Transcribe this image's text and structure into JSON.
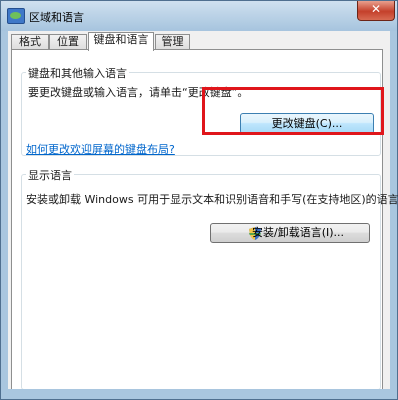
{
  "window": {
    "title": "区域和语言",
    "close_glyph": "✕"
  },
  "tabs": [
    {
      "label": "格式",
      "active": false
    },
    {
      "label": "位置",
      "active": false
    },
    {
      "label": "键盘和语言",
      "active": true
    },
    {
      "label": "管理",
      "active": false
    }
  ],
  "keyboards_group": {
    "title": "键盘和其他输入语言",
    "instruction": "要更改键盘或输入语言，请单击“更改键盘”。",
    "change_keyboard_button": "更改键盘(C)...",
    "help_link": "如何更改欢迎屏幕的键盘布局?"
  },
  "display_language_group": {
    "title": "显示语言",
    "description": "安装或卸载 Windows 可用于显示文本和识别语音和手写(在支持地区)的语言。",
    "install_button": "安装/卸载语言(I)..."
  },
  "colors": {
    "highlight_box": "#e0161b",
    "link": "#0066cc",
    "titlebar": "#a9c6df"
  }
}
